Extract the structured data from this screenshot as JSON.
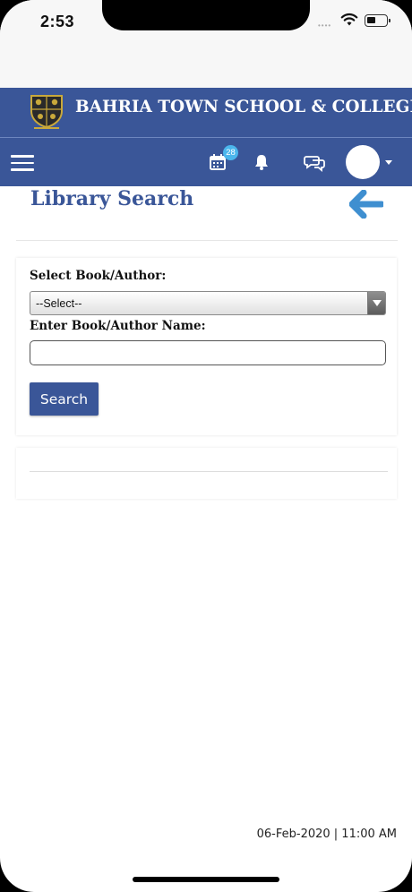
{
  "status_bar": {
    "time": "2:53",
    "signal_dots": "••••"
  },
  "header": {
    "school_name": "BAHRIA TOWN SCHOOL & COLLEGE"
  },
  "nav": {
    "calendar_badge": "28"
  },
  "page": {
    "title": "Library Search"
  },
  "form": {
    "select_label": "Select Book/Author:",
    "select_value": "--Select--",
    "name_label": "Enter Book/Author Name:",
    "name_value": "",
    "search_button": "Search"
  },
  "footer": {
    "datetime": "06-Feb-2020 | 11:00 AM"
  },
  "colors": {
    "primary": "#3a5698",
    "accent": "#4bb6ec"
  },
  "icons": [
    "wifi-icon",
    "battery-icon",
    "crest-logo",
    "menu-icon",
    "calendar-icon",
    "bell-icon",
    "chat-icon",
    "back-arrow-icon",
    "chevron-down-icon"
  ]
}
